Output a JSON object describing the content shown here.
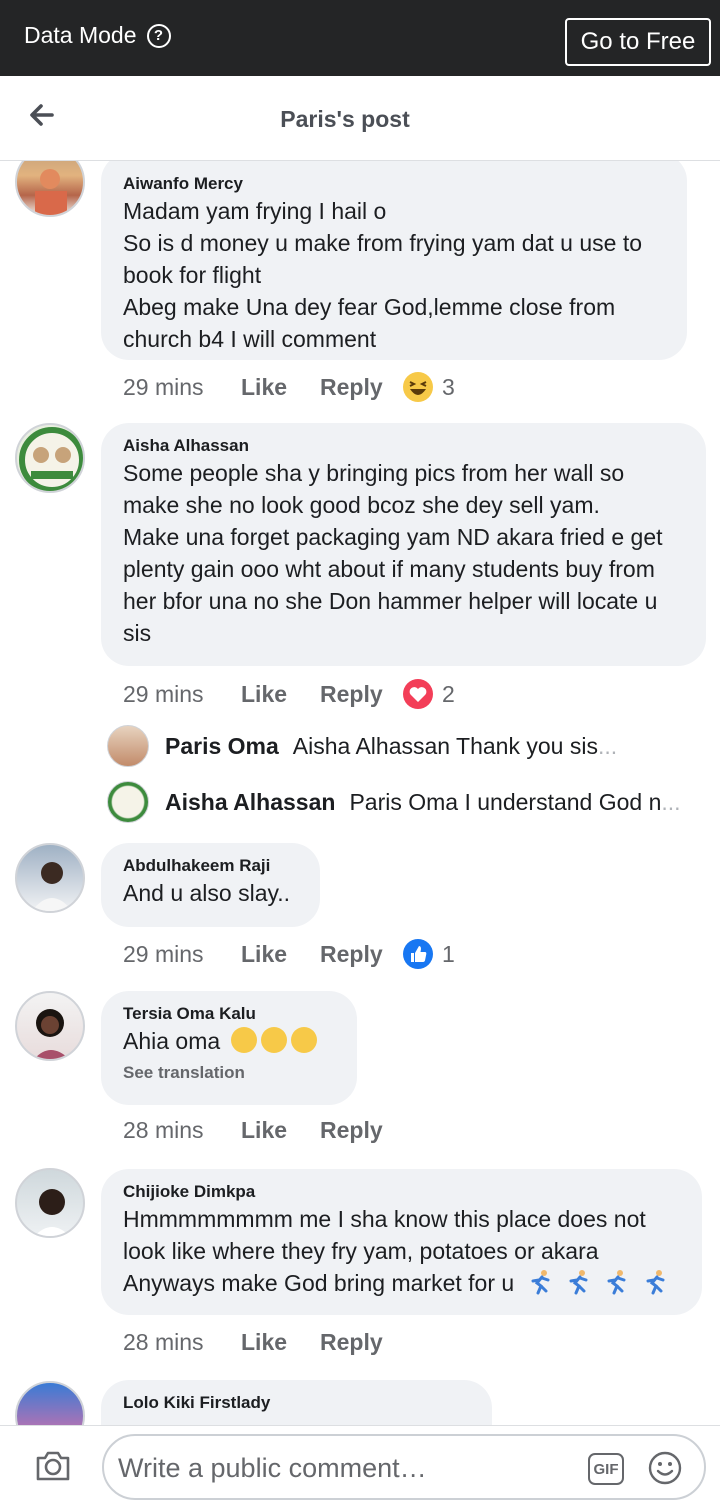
{
  "topbar": {
    "mode_label": "Data Mode",
    "help_glyph": "?",
    "free_button": "Go to Free"
  },
  "header": {
    "title": "Paris's post"
  },
  "comments": [
    {
      "name": "Aiwanfo Mercy",
      "lines": [
        "Madam yam frying I hail o",
        "So is d money u make from frying yam dat u use to",
        "book for flight",
        "Abeg make Una dey fear God,lemme close from",
        "church b4 I will comment"
      ],
      "time": "29 mins",
      "like": "Like",
      "reply": "Reply",
      "reaction": {
        "icon": "haha-icon",
        "count": "3"
      }
    },
    {
      "name": "Aisha Alhassan",
      "lines": [
        "Some people sha y bringing pics from her wall so",
        "make she no look good bcoz she dey sell yam.",
        "Make una forget packaging yam ND akara fried e get",
        "plenty gain ooo wht about if many students buy from",
        "her bfor una no she Don hammer helper will locate u",
        "sis"
      ],
      "time": "29 mins",
      "like": "Like",
      "reply": "Reply",
      "reaction": {
        "icon": "love-icon",
        "count": "2"
      },
      "replies": [
        {
          "name": "Paris Oma",
          "text": "Aisha Alhassan Thank you sis",
          "ellipsis": "..."
        },
        {
          "name": "Aisha Alhassan",
          "text": "Paris Oma I understand God n",
          "ellipsis": "..."
        }
      ]
    },
    {
      "name": "Abdulhakeem Raji",
      "lines": [
        "And u also slay.."
      ],
      "time": "29 mins",
      "like": "Like",
      "reply": "Reply",
      "reaction": {
        "icon": "like-icon",
        "count": "1"
      }
    },
    {
      "name": "Tersia Oma Kalu",
      "lines": [
        " Ahia oma"
      ],
      "translate": "See translation",
      "time": "28 mins",
      "like": "Like",
      "reply": "Reply"
    },
    {
      "name": "Chijioke Dimkpa",
      "lines": [
        "Hmmmmmmmm me I sha know this place does not",
        "look like where they fry yam, potatoes or akara",
        "Anyways make God bring market for u"
      ],
      "time": "28 mins",
      "like": "Like",
      "reply": "Reply"
    },
    {
      "name": "Lolo Kiki Firstlady",
      "lines": []
    }
  ],
  "composer": {
    "placeholder": "Write a public comment…",
    "gif_label": "GIF"
  },
  "colors": {
    "topbar": "#242526",
    "bubble": "#f0f2f5",
    "link": "#1877f2",
    "love": "#f33e58",
    "haha": "#f7c948"
  }
}
